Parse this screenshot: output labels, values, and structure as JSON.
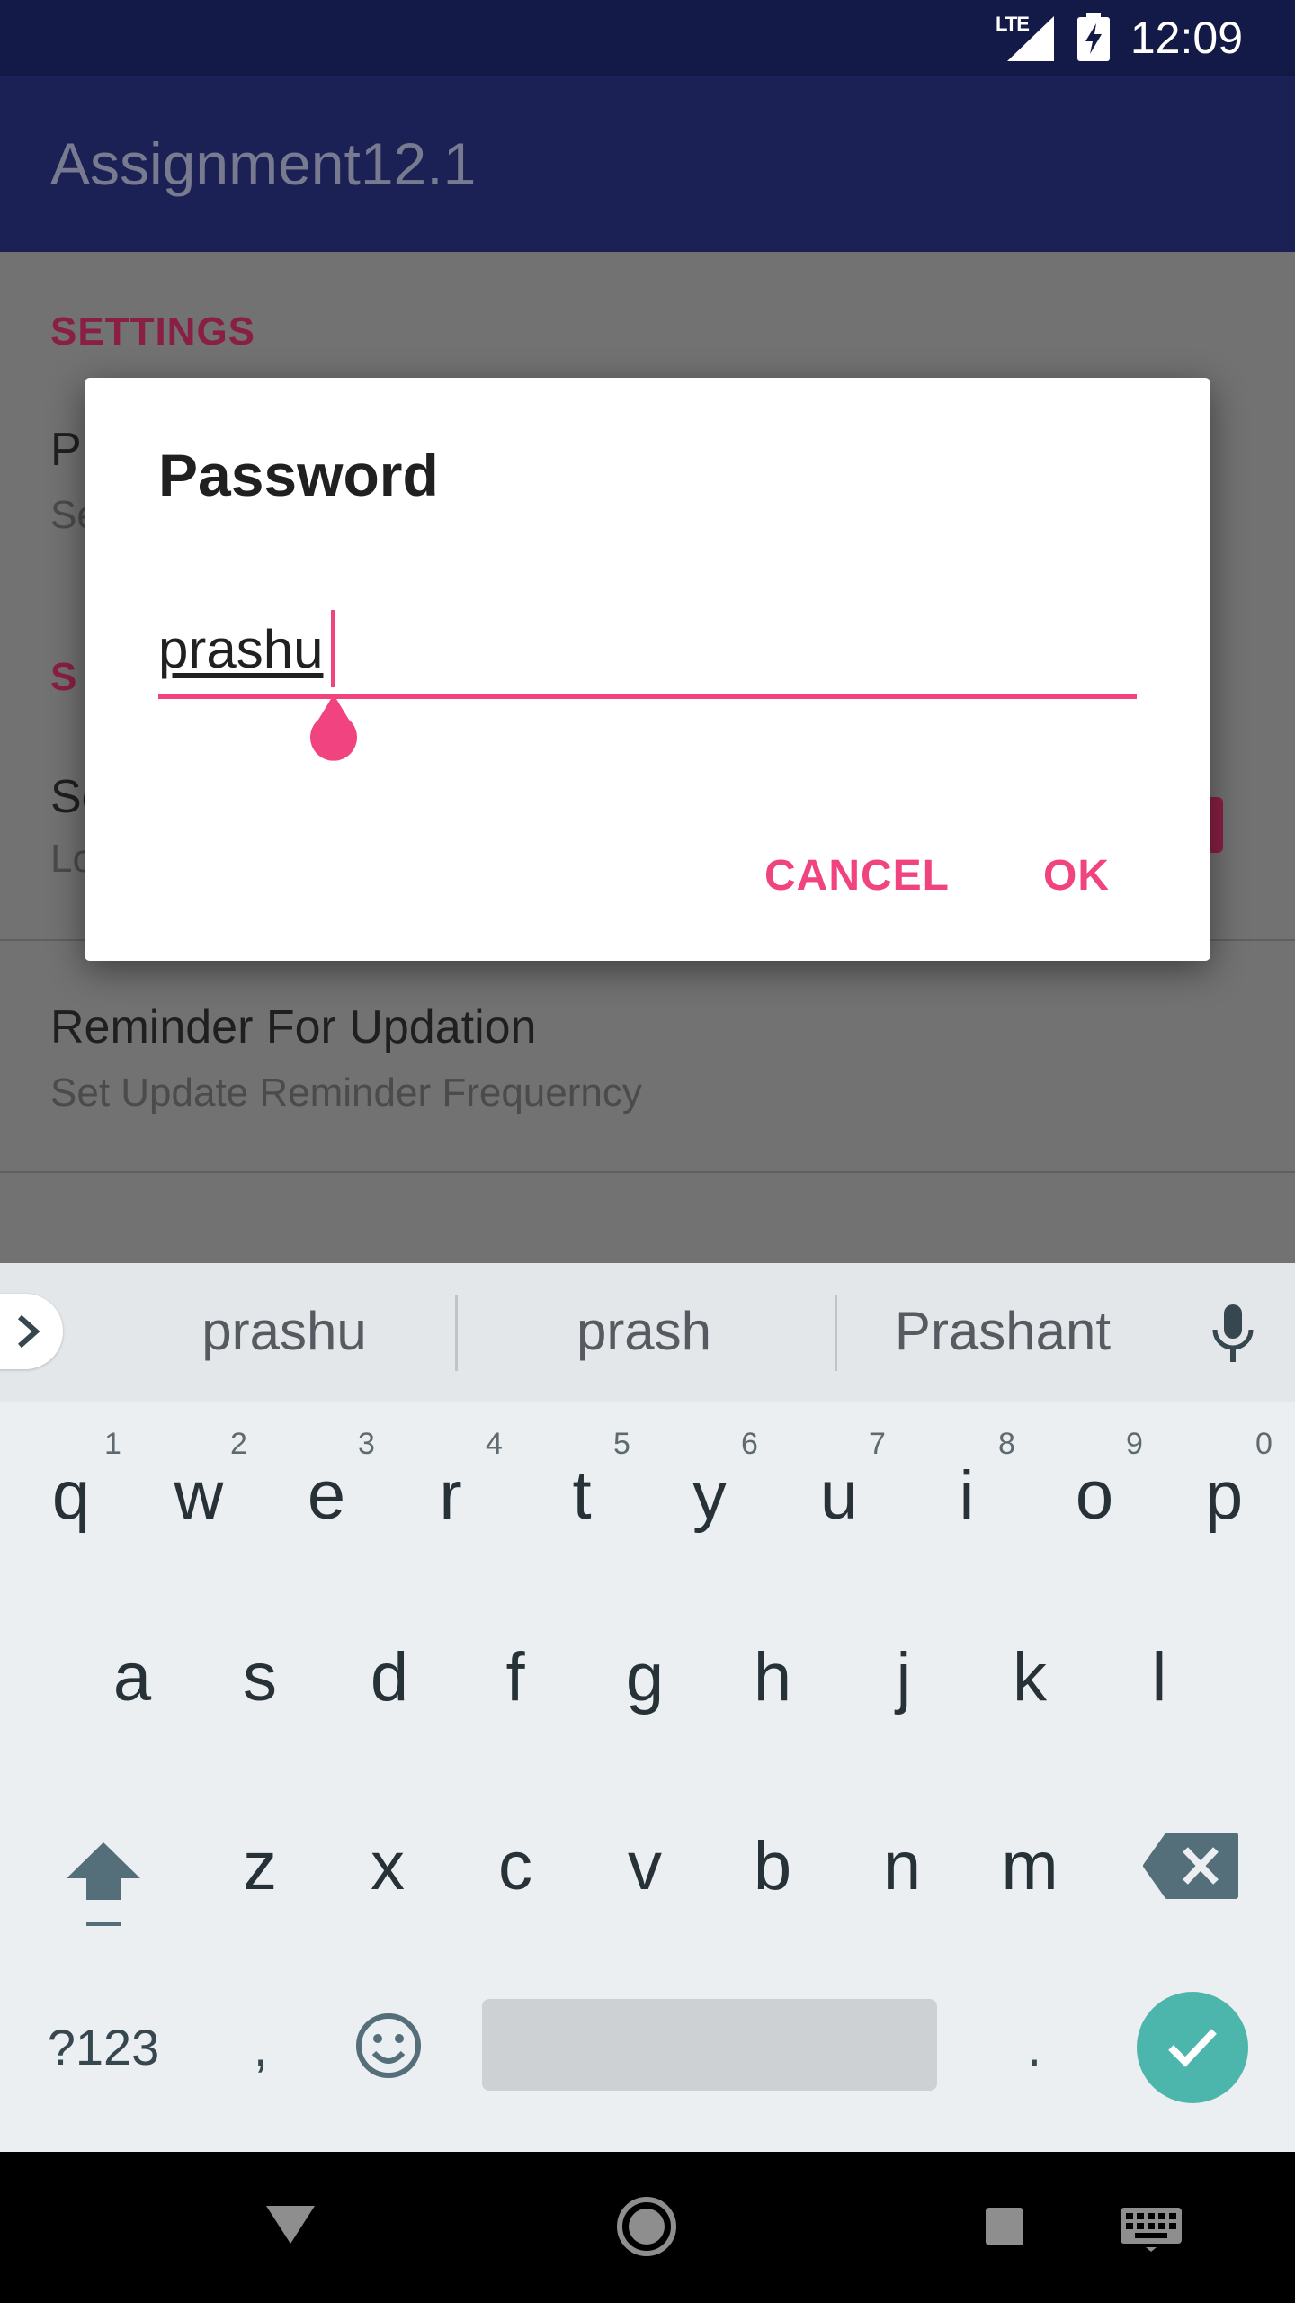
{
  "status_bar": {
    "time": "12:09",
    "network": "LTE"
  },
  "app_bar": {
    "title": "Assignment12.1"
  },
  "settings": {
    "category_1": "SETTINGS",
    "pref_1_title_peek": "P",
    "pref_1_summary_peek": "Se",
    "category_2_peek": "S",
    "pref_2_title_peek": "Se",
    "pref_2_summary_peek": "Lo",
    "pref_3_title": "Reminder For Updation",
    "pref_3_summary": "Set Update Reminder Frequerncy"
  },
  "dialog": {
    "title": "Password",
    "input_value": "prashu",
    "cancel_label": "CANCEL",
    "ok_label": "OK"
  },
  "keyboard": {
    "suggestions": [
      "prashu",
      "prash",
      "Prashant"
    ],
    "row1": [
      {
        "key": "q",
        "hint": "1"
      },
      {
        "key": "w",
        "hint": "2"
      },
      {
        "key": "e",
        "hint": "3"
      },
      {
        "key": "r",
        "hint": "4"
      },
      {
        "key": "t",
        "hint": "5"
      },
      {
        "key": "y",
        "hint": "6"
      },
      {
        "key": "u",
        "hint": "7"
      },
      {
        "key": "i",
        "hint": "8"
      },
      {
        "key": "o",
        "hint": "9"
      },
      {
        "key": "p",
        "hint": "0"
      }
    ],
    "row2": [
      "a",
      "s",
      "d",
      "f",
      "g",
      "h",
      "j",
      "k",
      "l"
    ],
    "row3": [
      "z",
      "x",
      "c",
      "v",
      "b",
      "n",
      "m"
    ],
    "symbols_label": "?123",
    "comma_label": ",",
    "period_label": "."
  },
  "colors": {
    "accent": "#f0437f",
    "primary_dark": "#141a47",
    "primary": "#1b2055",
    "enter_key": "#4db6ac"
  }
}
